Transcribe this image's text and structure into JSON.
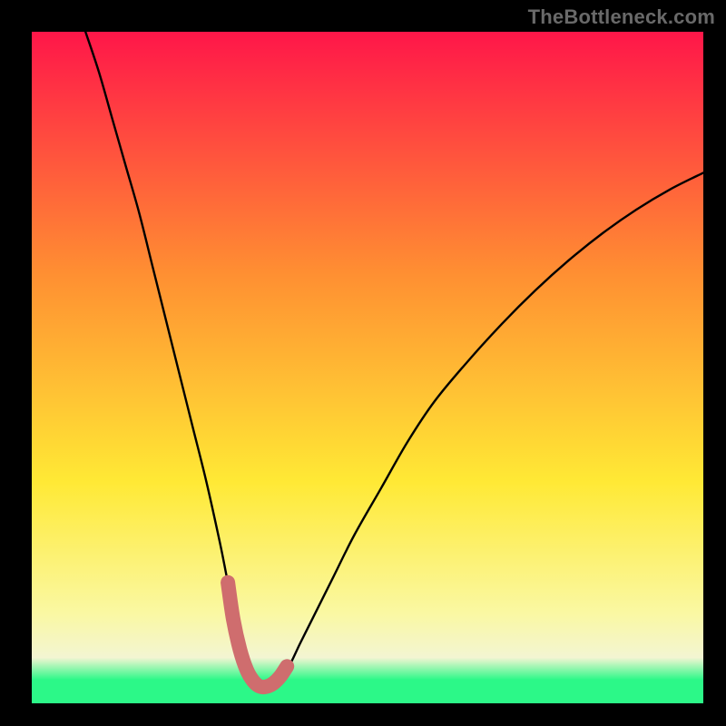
{
  "watermark": "TheBottleneck.com",
  "colors": {
    "curve": "#000000",
    "highlight": "#cf6d6e",
    "gradient_top": "#ff1649",
    "gradient_mid_upper": "#ff8f32",
    "gradient_mid": "#ffe935",
    "gradient_low_band_top": "#faf8a2",
    "gradient_low_band_bot": "#f3f5d2",
    "gradient_bottom": "#2cf888"
  },
  "chart_data": {
    "type": "line",
    "title": "",
    "xlabel": "",
    "ylabel": "",
    "xlim": [
      0,
      100
    ],
    "ylim": [
      0,
      100
    ],
    "series": [
      {
        "name": "bottleneck-curve",
        "x": [
          8,
          10,
          12,
          14,
          16,
          18,
          20,
          22,
          24,
          26,
          28,
          29,
          30,
          31,
          32,
          33,
          34,
          35,
          36,
          38,
          40,
          42,
          45,
          48,
          52,
          56,
          60,
          65,
          70,
          75,
          80,
          85,
          90,
          95,
          100
        ],
        "y": [
          100,
          94,
          87,
          80,
          73,
          65,
          57,
          49,
          41,
          33,
          24,
          19,
          14,
          9,
          5.5,
          3.3,
          2.5,
          2.5,
          3,
          5,
          9,
          13,
          19,
          25,
          32,
          39,
          45,
          51,
          56.5,
          61.5,
          66,
          70,
          73.5,
          76.5,
          79
        ]
      },
      {
        "name": "optimal-range-highlight",
        "x": [
          29.2,
          30,
          31,
          32,
          33,
          34,
          35,
          36,
          37,
          38
        ],
        "y": [
          18,
          12.5,
          8,
          5,
          3.3,
          2.5,
          2.5,
          3,
          4,
          5.5
        ]
      }
    ],
    "highlight_marker": {
      "x": 29.2,
      "y": 18
    },
    "gradient_stops": [
      {
        "offset": 0.0,
        "color_key": "gradient_top"
      },
      {
        "offset": 0.36,
        "color_key": "gradient_mid_upper"
      },
      {
        "offset": 0.67,
        "color_key": "gradient_mid"
      },
      {
        "offset": 0.865,
        "color_key": "gradient_low_band_top"
      },
      {
        "offset": 0.932,
        "color_key": "gradient_low_band_bot"
      },
      {
        "offset": 0.965,
        "color_key": "gradient_bottom"
      },
      {
        "offset": 1.0,
        "color_key": "gradient_bottom"
      }
    ]
  }
}
